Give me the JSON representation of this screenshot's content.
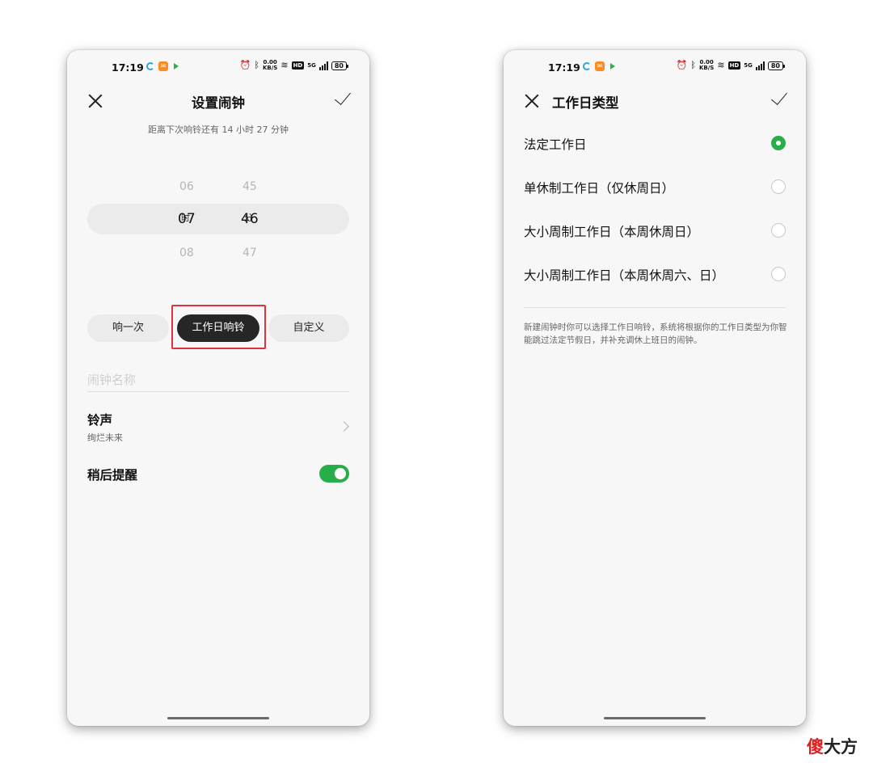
{
  "status_bar": {
    "time": "17:19",
    "net_speed_top": "0.00",
    "net_speed_bottom": "KB/S",
    "hd": "HD",
    "network": "5G",
    "battery": "80"
  },
  "left_screen": {
    "title": "设置闹钟",
    "subtitle": "距离下次响铃还有 14 小时 27 分钟",
    "picker": {
      "hour_prev": "06",
      "hour": "07",
      "hour_next": "08",
      "hour_unit": "时",
      "minute_prev": "45",
      "minute": "46",
      "minute_next": "47",
      "minute_unit": "分"
    },
    "repeat_options": [
      "响一次",
      "工作日响铃",
      "自定义"
    ],
    "repeat_selected": "工作日响铃",
    "name_placeholder": "闹钟名称",
    "ringtone": {
      "label": "铃声",
      "value": "绚烂未来"
    },
    "snooze": {
      "label": "稍后提醒",
      "enabled": true
    }
  },
  "right_screen": {
    "title": "工作日类型",
    "options": [
      {
        "label": "法定工作日",
        "selected": true
      },
      {
        "label": "单休制工作日（仅休周日）",
        "selected": false
      },
      {
        "label": "大小周制工作日（本周休周日）",
        "selected": false
      },
      {
        "label": "大小周制工作日（本周休周六、日）",
        "selected": false
      }
    ],
    "note": "新建闹钟时你可以选择工作日响铃，系统将根据你的工作日类型为你智能跳过法定节假日，并补充调休上班日的闹钟。"
  },
  "watermark": {
    "red": "傻",
    "black": "大方"
  },
  "colors": {
    "accent_green": "#27ae4a",
    "highlight_red": "#e0313f"
  }
}
